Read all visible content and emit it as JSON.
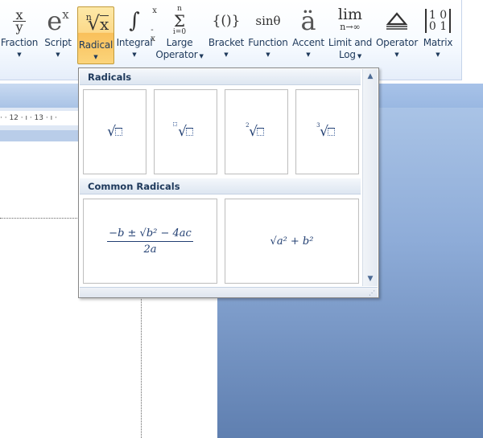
{
  "ribbon": {
    "buttons": [
      {
        "id": "fraction",
        "label": "Fraction",
        "icon": "fraction-icon"
      },
      {
        "id": "script",
        "label": "Script",
        "icon": "script-icon"
      },
      {
        "id": "radical",
        "label": "Radical",
        "icon": "radical-icon",
        "active": true
      },
      {
        "id": "integral",
        "label": "Integral",
        "icon": "integral-icon"
      },
      {
        "id": "large-operator",
        "label1": "Large",
        "label2": "Operator",
        "icon": "large-operator-icon"
      },
      {
        "id": "bracket",
        "label": "Bracket",
        "icon": "bracket-icon"
      },
      {
        "id": "function",
        "label": "Function",
        "icon": "function-icon"
      },
      {
        "id": "accent",
        "label": "Accent",
        "icon": "accent-icon"
      },
      {
        "id": "limit-log",
        "label1": "Limit and",
        "label2": "Log",
        "icon": "limit-icon"
      },
      {
        "id": "operator",
        "label": "Operator",
        "icon": "operator-icon"
      },
      {
        "id": "matrix",
        "label": "Matrix",
        "icon": "matrix-icon"
      }
    ],
    "icons_text": {
      "fraction_num": "x",
      "fraction_den": "y",
      "script_base": "e",
      "script_sup": "x",
      "radical_index": "n",
      "radical_sym": "√",
      "radical_arg": "x",
      "integral_sym": "∫",
      "integral_top": "x",
      "integral_bottom": "-x",
      "sum_top": "n",
      "sum_sym": "Σ",
      "sum_bottom": "i=0",
      "bracket": "{()}",
      "function": "sinθ",
      "accent": "ä",
      "limit_top": "lim",
      "limit_bottom": "n→∞",
      "matrix_row1": "1 0",
      "matrix_row2": "0 1"
    }
  },
  "ruler": {
    "text": "· · 12 · ı · 13 · ı ·"
  },
  "gallery": {
    "section1_title": "Radicals",
    "section2_title": "Common Radicals",
    "radicals": [
      {
        "name": "square-root",
        "index": ""
      },
      {
        "name": "nth-root",
        "index": "box"
      },
      {
        "name": "square-root-index-2",
        "index": "2"
      },
      {
        "name": "cube-root",
        "index": "3"
      }
    ],
    "common": {
      "quadratic_numerator": "−b ± √b² − 4ac",
      "quadratic_denominator": "2a",
      "pythagorean": "√a² + b²"
    }
  }
}
